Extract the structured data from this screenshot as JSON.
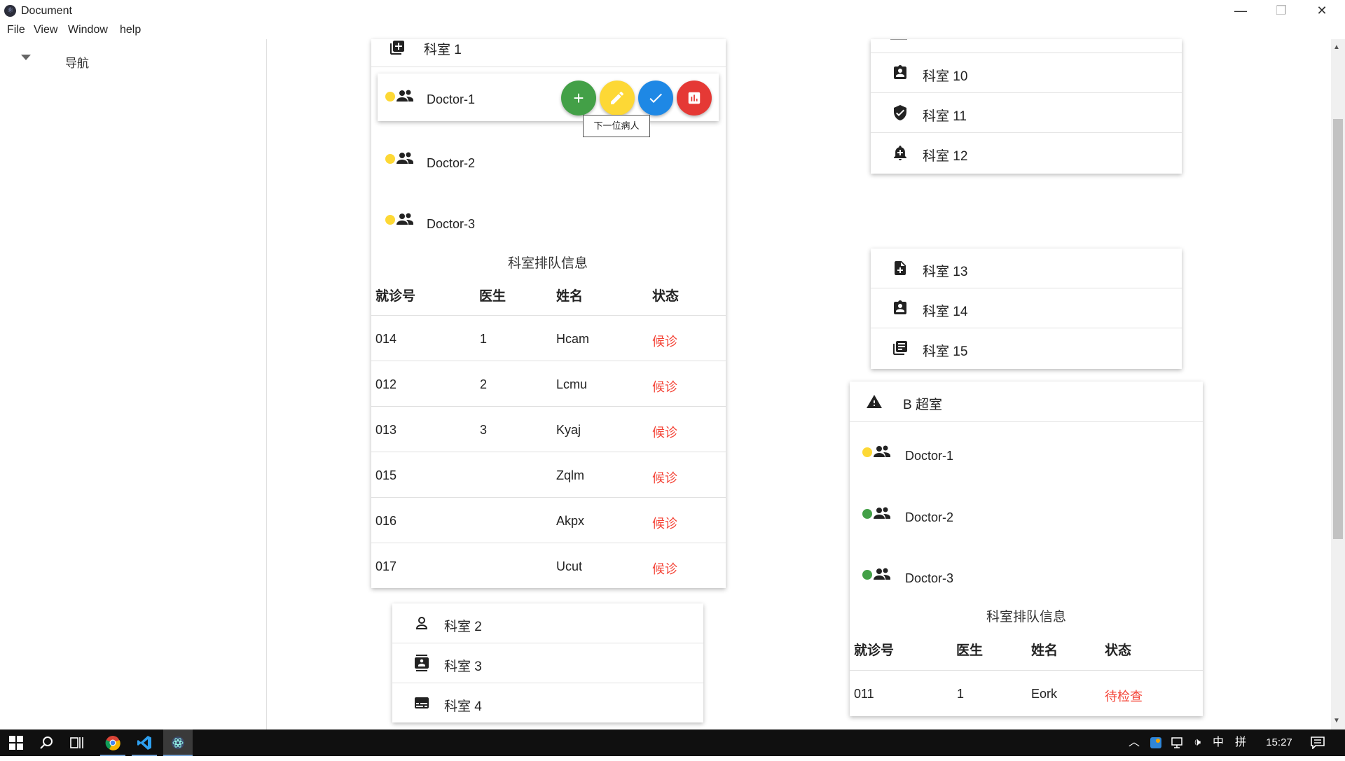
{
  "window": {
    "title": "Document",
    "minimize": "—",
    "maximize": "❐",
    "close": "✕"
  },
  "menu": [
    "File",
    "View",
    "Window",
    "help"
  ],
  "sidebar": {
    "nav_label": "导航"
  },
  "dept1": {
    "label": "科室 1",
    "doctors": [
      {
        "name": "Doctor-1",
        "status_color": "#fdd835"
      },
      {
        "name": "Doctor-2",
        "status_color": "#fdd835"
      },
      {
        "name": "Doctor-3",
        "status_color": "#fdd835"
      }
    ],
    "fab_colors": {
      "add": "#43a047",
      "edit": "#fdd835",
      "done": "#1e88e5",
      "stats": "#e53935"
    },
    "tooltip": "下一位病人",
    "queue_title": "科室排队信息",
    "headers": [
      "就诊号",
      "医生",
      "姓名",
      "状态"
    ],
    "rows": [
      {
        "id": "014",
        "doctor": "1",
        "name": "Hcam",
        "status": "候诊"
      },
      {
        "id": "012",
        "doctor": "2",
        "name": "Lcmu",
        "status": "候诊"
      },
      {
        "id": "013",
        "doctor": "3",
        "name": "Kyaj",
        "status": "候诊"
      },
      {
        "id": "015",
        "doctor": "",
        "name": "Zqlm",
        "status": "候诊"
      },
      {
        "id": "016",
        "doctor": "",
        "name": "Akpx",
        "status": "候诊"
      },
      {
        "id": "017",
        "doctor": "",
        "name": "Ucut",
        "status": "候诊"
      }
    ]
  },
  "dept_group_a": [
    "科室 2",
    "科室 3",
    "科室 4"
  ],
  "dept_group_b": [
    "科室 10",
    "科室 11",
    "科室 12"
  ],
  "dept_group_c": [
    "科室 13",
    "科室 14",
    "科室 15"
  ],
  "ultrasound": {
    "label": "B 超室",
    "doctors": [
      {
        "name": "Doctor-1",
        "status_color": "#fdd835"
      },
      {
        "name": "Doctor-2",
        "status_color": "#43a047"
      },
      {
        "name": "Doctor-3",
        "status_color": "#43a047"
      }
    ],
    "queue_title": "科室排队信息",
    "headers": [
      "就诊号",
      "医生",
      "姓名",
      "状态"
    ],
    "rows": [
      {
        "id": "011",
        "doctor": "1",
        "name": "Eork",
        "status": "待检查"
      }
    ]
  },
  "taskbar": {
    "time": "15:27",
    "ime_lang": "中",
    "ime_mode": "拼"
  }
}
